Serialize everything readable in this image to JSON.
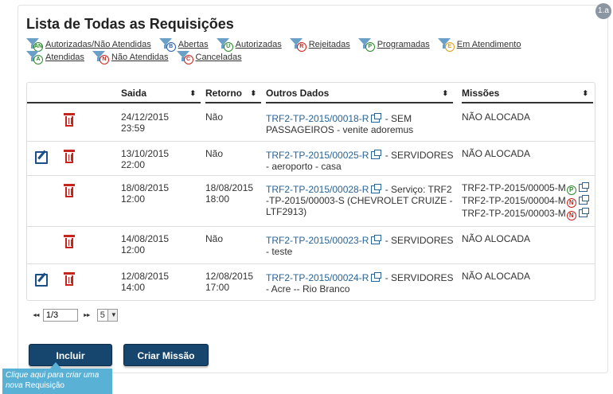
{
  "badge": "1.a",
  "title": "Lista de Todas as Requisições",
  "filters": {
    "row1": [
      {
        "code": "AN",
        "color": "#2e8b2e",
        "label": "Autorizadas/Não Atendidas"
      },
      {
        "code": "B",
        "color": "#2a5fb0",
        "label": "Abertas"
      },
      {
        "code": "U",
        "color": "#2e8b2e",
        "label": "Autorizadas"
      },
      {
        "code": "R",
        "color": "#c9241b",
        "label": "Rejeitadas"
      },
      {
        "code": "P",
        "color": "#2e8b2e",
        "label": "Programadas"
      },
      {
        "code": "E",
        "color": "#e0a020",
        "label": "Em Atendimento"
      }
    ],
    "row2": [
      {
        "code": "A",
        "color": "#2e8b2e",
        "label": "Atendidas"
      },
      {
        "code": "N",
        "color": "#c9241b",
        "label": "Não Atendidas"
      },
      {
        "code": "C",
        "color": "#c9241b",
        "label": "Canceladas"
      }
    ]
  },
  "table": {
    "headers": {
      "saida": "Saida",
      "retorno": "Retorno",
      "outros": "Outros Dados",
      "missoes": "Missões"
    },
    "sort_icon": "⬍",
    "rows": [
      {
        "editable": false,
        "saida_date": "24/12/2015",
        "saida_time": "23:59",
        "retorno_date": "Não",
        "retorno_time": "",
        "req": "TRF2-TP-2015/00018-R",
        "outros_rest": " - SEM PASSAGEIROS - venite adoremus",
        "missoes": [
          {
            "text": "NÃO ALOCADA"
          }
        ]
      },
      {
        "editable": true,
        "saida_date": "13/10/2015",
        "saida_time": "22:00",
        "retorno_date": "Não",
        "retorno_time": "",
        "req": "TRF2-TP-2015/00025-R",
        "outros_rest": " - SERVIDORES - aeroporto - casa",
        "missoes": [
          {
            "text": "NÃO ALOCADA"
          }
        ]
      },
      {
        "editable": false,
        "saida_date": "18/08/2015",
        "saida_time": "12:00",
        "retorno_date": "18/08/2015",
        "retorno_time": "18:00",
        "req": "TRF2-TP-2015/00028-R",
        "outros_rest": " - Serviço: TRF2 -TP-2015/00003-S (CHEVROLET CRUIZE - LTF2913)",
        "missoes": [
          {
            "text": "TRF2-TP-2015/00005-M",
            "code": "P",
            "color": "#2e8b2e"
          },
          {
            "text": "TRF2-TP-2015/00004-M",
            "code": "N",
            "color": "#c9241b"
          },
          {
            "text": "TRF2-TP-2015/00003-M",
            "code": "N",
            "color": "#c9241b"
          }
        ]
      },
      {
        "editable": false,
        "saida_date": "14/08/2015",
        "saida_time": "12:00",
        "retorno_date": "Não",
        "retorno_time": "",
        "req": "TRF2-TP-2015/00023-R",
        "outros_rest": " - SERVIDORES - teste",
        "missoes": [
          {
            "text": "NÃO ALOCADA"
          }
        ]
      },
      {
        "editable": true,
        "saida_date": "12/08/2015",
        "saida_time": "14:00",
        "retorno_date": "12/08/2015",
        "retorno_time": "17:00",
        "req": "TRF2-TP-2015/00024-R",
        "outros_rest": " - SERVIDORES - Acre -- Rio Branco",
        "missoes": [
          {
            "text": "NÃO ALOCADA"
          }
        ]
      }
    ]
  },
  "pager": {
    "first": "◄◄",
    "prev": "◄◄",
    "page": "1/3",
    "next": "►►",
    "last": "►►",
    "page_size": "5",
    "arrow": "▼"
  },
  "buttons": {
    "incluir": "Incluir",
    "criar_missao": "Criar Missão"
  },
  "tooltip": {
    "line1": "Clique aqui para criar uma",
    "line2_italic": "nova",
    "line2": " Requisição"
  }
}
